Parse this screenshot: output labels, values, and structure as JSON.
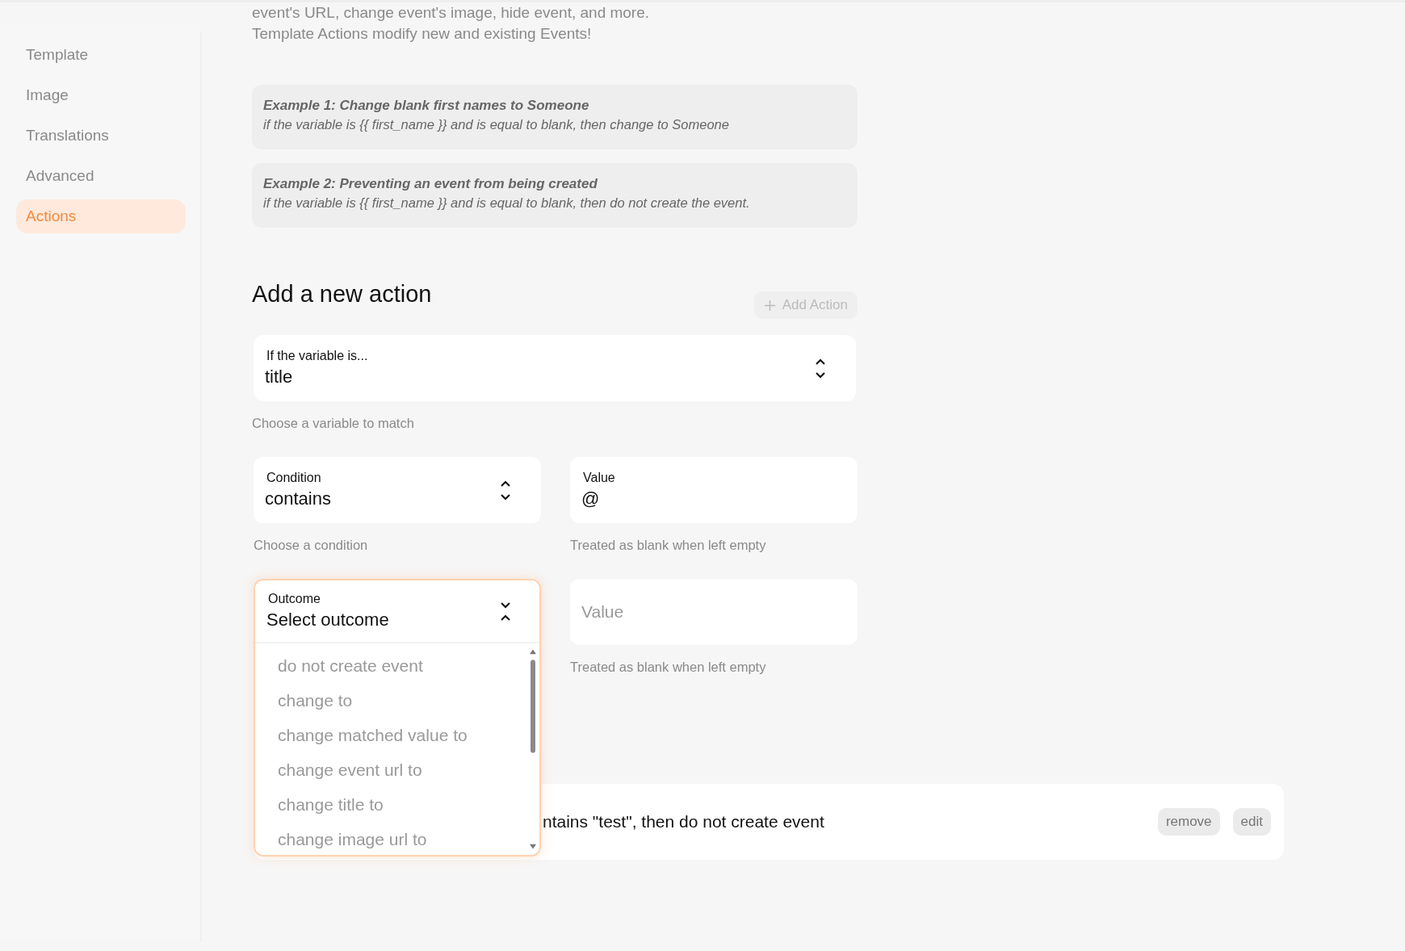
{
  "sidebar": {
    "items": [
      {
        "label": "Template",
        "selected": false
      },
      {
        "label": "Image",
        "selected": false
      },
      {
        "label": "Translations",
        "selected": false
      },
      {
        "label": "Advanced",
        "selected": false
      },
      {
        "label": "Actions",
        "selected": true
      }
    ]
  },
  "intro": [
    "event's URL, change event's image, hide event, and more.",
    "Template Actions modify new and existing Events!"
  ],
  "examples": [
    {
      "title": "Example 1: Change blank first names to Someone",
      "text": "if the variable is {{ first_name }} and is equal to blank, then change to Someone"
    },
    {
      "title": "Example 2: Preventing an event from being created",
      "text": "if the variable is {{ first_name }} and is equal to blank, then do not create the event."
    }
  ],
  "form": {
    "heading": "Add a new action",
    "add_button": {
      "label": "Add Action",
      "disabled": true
    },
    "variable": {
      "label": "If the variable is...",
      "value": "title",
      "open": false,
      "hint": "Choose a variable to match"
    },
    "condition": {
      "label": "Condition",
      "value": "contains",
      "open": false,
      "hint": "Choose a condition"
    },
    "value": {
      "label": "Value",
      "value": "@",
      "hint": "Treated as blank when left empty"
    },
    "outcome": {
      "label": "Outcome",
      "value": "Select outcome",
      "open": true,
      "options": [
        "do not create event",
        "change to",
        "change matched value to",
        "change event url to",
        "change title to",
        "change image url to"
      ]
    },
    "outcome_value": {
      "placeholder": "Value",
      "hint": "Treated as blank when left empty"
    }
  },
  "actions": [
    {
      "text": "ntains \"test\", then do not create event",
      "buttons": [
        "remove",
        "edit"
      ]
    }
  ]
}
